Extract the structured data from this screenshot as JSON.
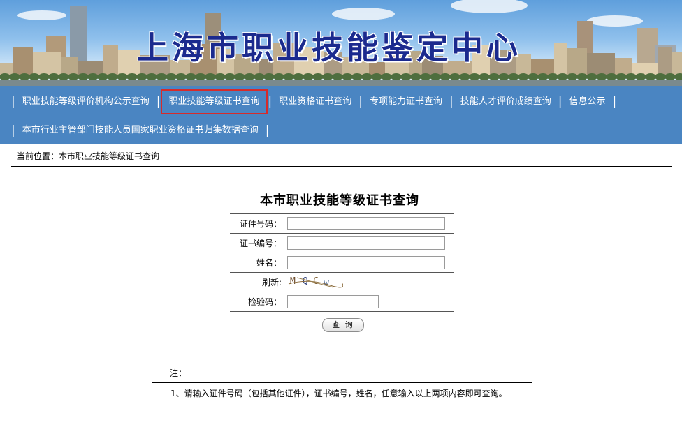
{
  "banner": {
    "title": "上海市职业技能鉴定中心"
  },
  "nav": {
    "items": [
      {
        "label": "职业技能等级评价机构公示查询"
      },
      {
        "label": "职业技能等级证书查询"
      },
      {
        "label": "职业资格证书查询"
      },
      {
        "label": "专项能力证书查询"
      },
      {
        "label": "技能人才评价成绩查询"
      },
      {
        "label": "信息公示"
      },
      {
        "label": "本市行业主管部门技能人员国家职业资格证书归集数据查询"
      }
    ],
    "separator": "|",
    "active_index": 1,
    "active_color": "#d62b2b"
  },
  "breadcrumb": {
    "text": "当前位置：本市职业技能等级证书查询"
  },
  "form": {
    "title": "本市职业技能等级证书查询",
    "id_label": "证件号码：",
    "id_value": "",
    "cert_label": "证书编号：",
    "cert_value": "",
    "name_label": "姓名：",
    "name_value": "",
    "refresh_label": "刷新:",
    "captcha_chars": [
      "M",
      "Q",
      "C",
      "w"
    ],
    "captcha_colors": [
      "#6b4a2a",
      "#2c3f7a",
      "#7a5a2c",
      "#3a5a8a"
    ],
    "code_label": "检验码：",
    "code_value": "",
    "submit_label": "查 询"
  },
  "note": {
    "label": "注：",
    "text": "1、请输入证件号码（包括其他证件），证书编号，姓名，任意输入以上两项内容即可查询。"
  },
  "colors": {
    "nav_bg": "#4a85c2",
    "title_blue": "#1b2a8e"
  }
}
